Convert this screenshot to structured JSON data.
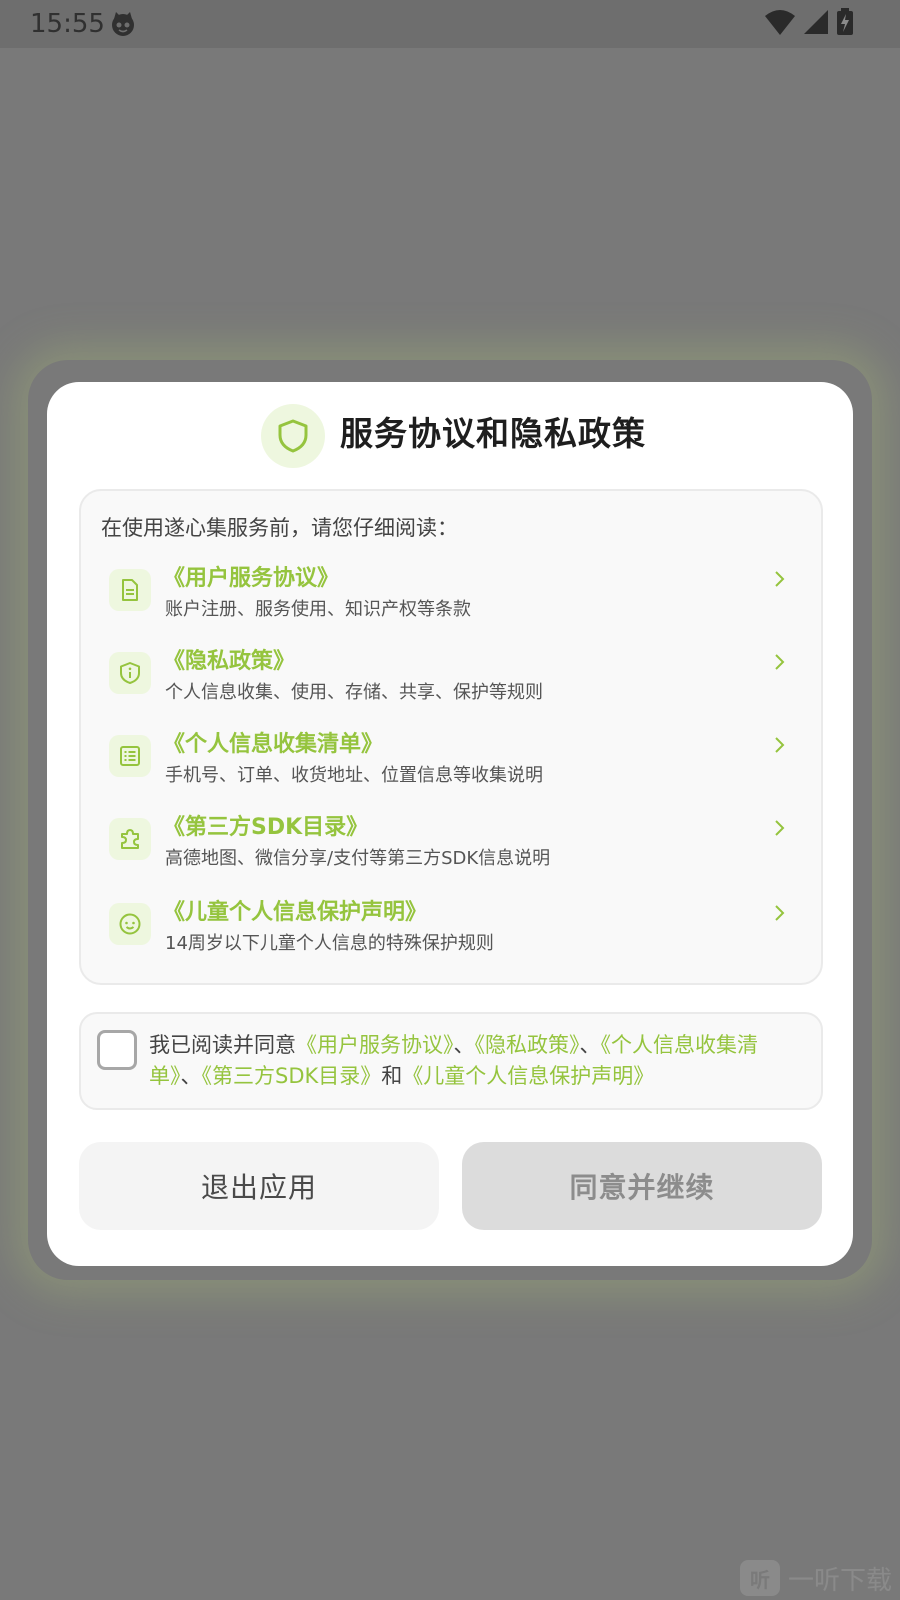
{
  "status_bar": {
    "time": "15:55",
    "icons": [
      "cat-icon",
      "wifi-icon",
      "signal-icon",
      "battery-charging-icon"
    ]
  },
  "dialog": {
    "title": "服务协议和隐私政策",
    "title_icon": "shield-icon",
    "intro": "在使用遂心集服务前，请您仔细阅读：",
    "documents": [
      {
        "name": "《用户服务协议》",
        "desc": "账户注册、服务使用、知识产权等条款",
        "icon": "document-icon"
      },
      {
        "name": "《隐私政策》",
        "desc": "个人信息收集、使用、存储、共享、保护等规则",
        "icon": "shield-info-icon"
      },
      {
        "name": "《个人信息收集清单》",
        "desc": "手机号、订单、收货地址、位置信息等收集说明",
        "icon": "list-icon"
      },
      {
        "name": "《第三方SDK目录》",
        "desc": "高德地图、微信分享/支付等第三方SDK信息说明",
        "icon": "puzzle-icon"
      },
      {
        "name": "《儿童个人信息保护声明》",
        "desc": "14周岁以下儿童个人信息的特殊保护规则",
        "icon": "child-face-icon"
      }
    ],
    "agreement": {
      "prefix": "我已阅读并同意",
      "link1": "《用户服务协议》",
      "sep1": "、",
      "link2": "《隐私政策》",
      "sep2": "、",
      "link3": "《个人信息收集清单》",
      "sep3": "、",
      "link4": "《第三方SDK目录》",
      "and": "和",
      "link5": "《儿童个人信息保护声明》",
      "checked": false
    },
    "buttons": {
      "exit_label": "退出应用",
      "agree_label": "同意并继续"
    }
  },
  "watermark": {
    "logo_text": "听",
    "text": "一听下载"
  },
  "colors": {
    "accent": "#95c43e",
    "accent_bg": "#eef7df",
    "overlay": "#797979",
    "disabled_button": "#dcdcdc"
  }
}
